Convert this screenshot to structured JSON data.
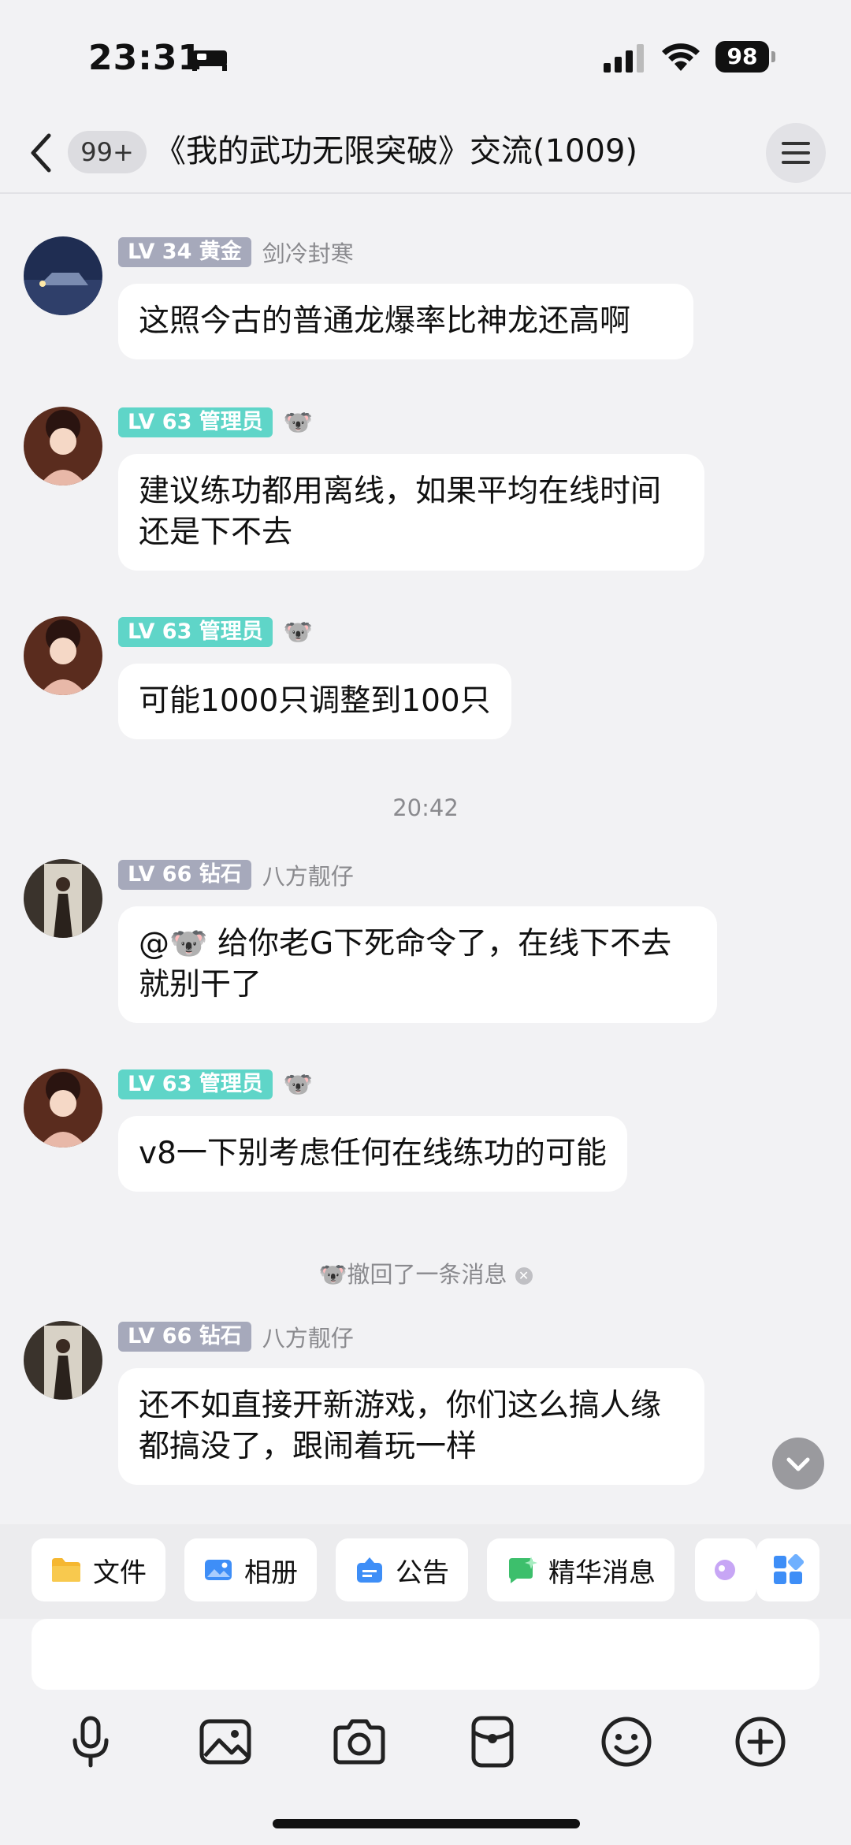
{
  "status_bar": {
    "time": "23:31",
    "battery": "98"
  },
  "header": {
    "unread_badge": "99+",
    "title": "《我的武功无限突破》交流(1009)"
  },
  "messages": [
    {
      "level": "LV 34",
      "tier": "黄金",
      "nickname": "剑冷封寒",
      "text": "这照今古的普通龙爆率比神龙还高啊"
    },
    {
      "level": "LV 63",
      "tier": "管理员",
      "tag": "🐨",
      "text": "建议练功都用离线，如果平均在线时间还是下不去"
    },
    {
      "level": "LV 63",
      "tier": "管理员",
      "tag": "🐨",
      "text": "可能1000只调整到100只"
    },
    {
      "level": "LV 66",
      "tier": "钻石",
      "nickname": "八方靓仔",
      "text": "@🐨 给你老G下死命令了，在线下不去就别干了"
    },
    {
      "level": "LV 63",
      "tier": "管理员",
      "tag": "🐨",
      "text": "v8一下别考虑任何在线练功的可能"
    },
    {
      "level": "LV 66",
      "tier": "钻石",
      "nickname": "八方靓仔",
      "text": "还不如直接开新游戏，你们这么搞人缘都搞没了，跟闹着玩一样"
    }
  ],
  "time_divider": "20:42",
  "recall_notice": "🐨撤回了一条消息",
  "quick_bar": {
    "file": "文件",
    "album": "相册",
    "notice": "公告",
    "featured": "精华消息"
  },
  "colors": {
    "badge_gray": "#a6a9bb",
    "badge_teal": "#5fd5c8",
    "background": "#f2f2f4"
  },
  "icons": [
    "back-arrow-icon",
    "menu-icon",
    "mic-icon",
    "image-icon",
    "camera-icon",
    "red-packet-icon",
    "emoji-icon",
    "plus-icon",
    "folder-icon",
    "album-icon",
    "notice-icon",
    "featured-icon",
    "apps-icon",
    "chevron-down-icon"
  ]
}
